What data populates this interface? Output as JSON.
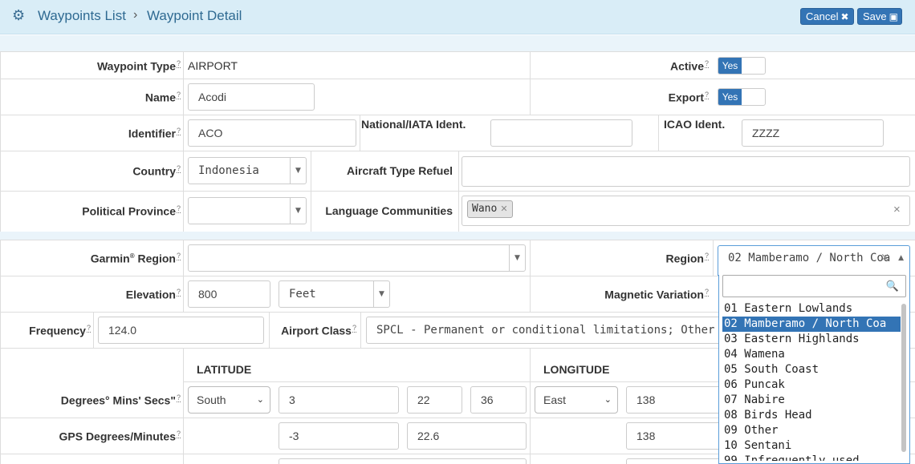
{
  "header": {
    "breadcrumb_parent": "Waypoints List",
    "breadcrumb_sep": "›",
    "breadcrumb_current": "Waypoint Detail",
    "cancel_label": "Cancel",
    "save_label": "Save",
    "icons": [
      "gear-icon",
      "close-icon",
      "save-icon"
    ]
  },
  "help_mark": "?",
  "general": {
    "waypoint_type_label": "Waypoint Type",
    "waypoint_type_value": "AIRPORT",
    "active_label": "Active",
    "active_value": "Yes",
    "name_label": "Name",
    "name_value": "Acodi",
    "export_label": "Export",
    "export_value": "Yes",
    "identifier_label": "Identifier",
    "identifier_value": "ACO",
    "national_iata_label": "National/IATA Ident.",
    "national_iata_value": "",
    "icao_label": "ICAO Ident.",
    "icao_value": "ZZZZ",
    "country_label": "Country",
    "country_value": "Indonesia",
    "aircraft_refuel_label": "Aircraft Type Refuel",
    "aircraft_refuel_value": "",
    "province_label": "Political Province",
    "province_value": "",
    "language_label": "Language Communities",
    "language_tags": [
      "Wano"
    ]
  },
  "location": {
    "garmin_label_pre": "Garmin",
    "garmin_sup": "®",
    "garmin_label_post": " Region",
    "garmin_value": "",
    "region_label": "Region",
    "region_value": "02 Mamberamo / North Coa",
    "elevation_label": "Elevation",
    "elevation_value": "800",
    "elevation_unit": "Feet",
    "magvar_label": "Magnetic Variation",
    "frequency_label": "Frequency",
    "frequency_value": "124.0",
    "airport_class_label": "Airport Class",
    "airport_class_value": "SPCL - Permanent or conditional limitations; Other th"
  },
  "coords": {
    "lat_header": "LATITUDE",
    "lon_header": "LONGITUDE",
    "dms_label": "Degrees° Mins' Secs\"",
    "lat_hemi": "South",
    "lat_deg": "3",
    "lat_min": "22",
    "lat_sec": "36",
    "lon_hemi": "East",
    "lon_deg": "138",
    "gps_label": "GPS Degrees/Minutes",
    "gps_lat_deg": "-3",
    "gps_lat_min": "22.6",
    "gps_lon_deg": "138"
  },
  "region_dropdown": {
    "search_value": "",
    "options": [
      "01 Eastern Lowlands",
      "02 Mamberamo / North Coa",
      "03 Eastern Highlands",
      "04 Wamena",
      "05 South Coast",
      "06 Puncak",
      "07 Nabire",
      "08 Birds Head",
      "09 Other",
      "10 Sentani",
      "99 Infrequently used"
    ],
    "selected_index": 1
  },
  "colors": {
    "accent": "#3374b5",
    "header_bg": "#d9edf7",
    "link": "#2f6a92"
  }
}
